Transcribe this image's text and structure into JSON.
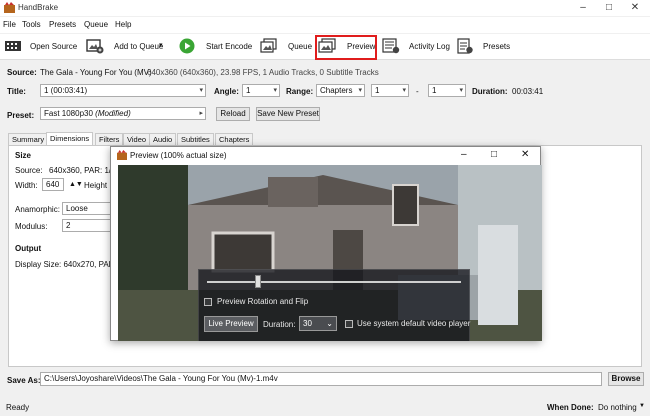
{
  "window": {
    "app_title": "HandBrake"
  },
  "menu": {
    "items": [
      "File",
      "Tools",
      "Presets",
      "Queue",
      "Help"
    ]
  },
  "toolbar": {
    "open_source": "Open Source",
    "add_to_queue": "Add to Queue",
    "start_encode": "Start Encode",
    "queue": "Queue",
    "preview": "Preview",
    "activity_log": "Activity Log",
    "presets": "Presets"
  },
  "source": {
    "label": "Source:",
    "name": "The Gala - Young For You (MV)",
    "info": "640x360 (640x360), 23.98 FPS, 1 Audio Tracks, 0 Subtitle Tracks"
  },
  "title_row": {
    "title_label": "Title:",
    "title_value": "1 (00:03:41)",
    "angle_label": "Angle:",
    "angle_value": "1",
    "range_label": "Range:",
    "range_type": "Chapters",
    "range_start": "1",
    "range_dash": "-",
    "range_end": "1",
    "duration_label": "Duration:",
    "duration_value": "00:03:41"
  },
  "preset_row": {
    "label": "Preset:",
    "value": "Fast 1080p30",
    "modified": "(Modified)",
    "reload": "Reload",
    "save_new": "Save New Preset"
  },
  "tabs": [
    "Summary",
    "Dimensions",
    "Filters",
    "Video",
    "Audio",
    "Subtitles",
    "Chapters"
  ],
  "active_tab": "Dimensions",
  "dimensions": {
    "size_heading": "Size",
    "source_label": "Source:",
    "source_value": "640x360, PAR: 1/1",
    "width_label": "Width:",
    "width_value": "640",
    "height_label": "Height",
    "anamorphic_label": "Anamorphic:",
    "anamorphic_value": "Loose",
    "modulus_label": "Modulus:",
    "modulus_value": "2",
    "output_heading": "Output",
    "display_size": "Display Size: 640x270,  PAR 1"
  },
  "preview_window": {
    "title": "Preview (100% actual size)",
    "rotation_label": "Preview Rotation and Flip",
    "live_preview": "Live Preview",
    "duration_label": "Duration:",
    "duration_value": "30",
    "system_player_label": "Use system default video player",
    "scrubber_position": 0.2
  },
  "save_as": {
    "label": "Save As:",
    "path": "C:\\Users\\Joyoshare\\Videos\\The Gala - Young For You (Mv)-1.m4v",
    "browse": "Browse"
  },
  "status": {
    "text": "Ready",
    "when_done_label": "When Done:",
    "when_done_value": "Do nothing"
  },
  "colors": {
    "highlight": "#e01c1c",
    "start_green": "#3aa534"
  }
}
